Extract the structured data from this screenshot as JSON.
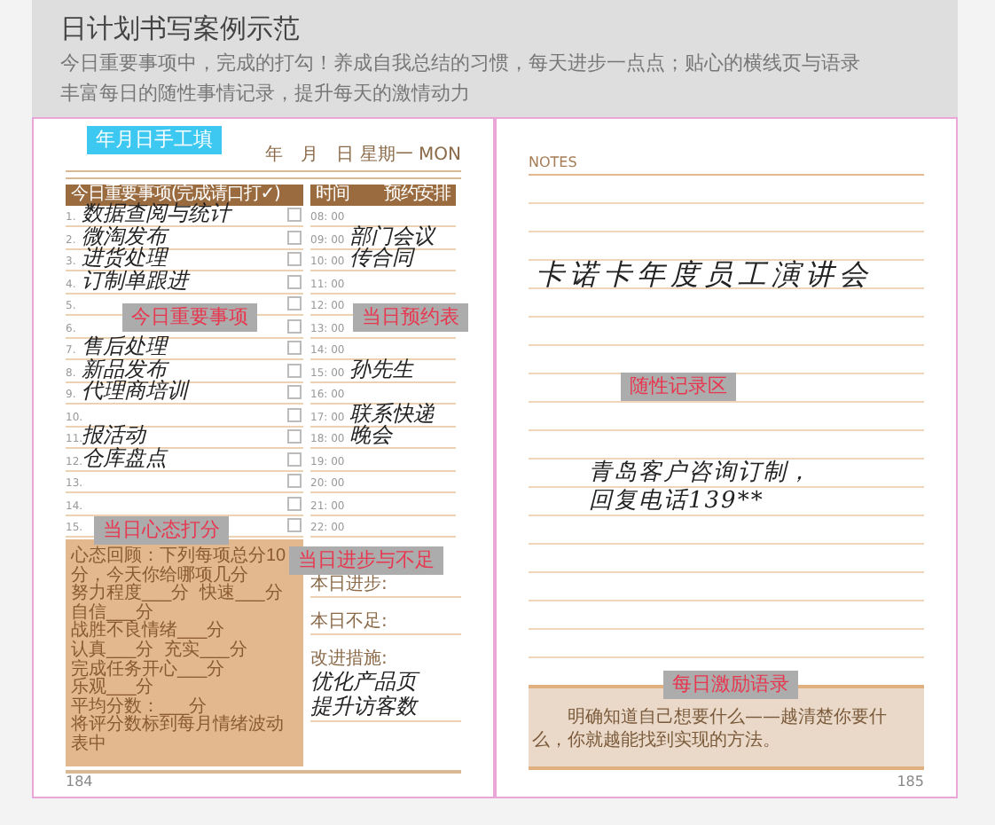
{
  "header": {
    "title": "日计划书写案例示范",
    "description": [
      "今日重要事项中，完成的打勾！养成自我总结的习惯，每天进步一点点；贴心的横线页与语录",
      "丰富每日的随性事情记录，提升每天的激情动力"
    ]
  },
  "left_page": {
    "date_callout": "年月日手工填",
    "date_line": "年　月　日 星期一 MON",
    "tasks_heading": "今日重要事项(完成请口打✓)",
    "time_heading": "时间",
    "appointment_heading": "预约安排",
    "tasks_callout": "今日重要事项",
    "schedule_callout": "当日预约表",
    "rows": [
      {
        "number": "1.",
        "task": "数据查阅与统计",
        "checked": false,
        "time": "08: 00"
      },
      {
        "number": "2.",
        "task": "微淘发布",
        "checked": false,
        "time": "09: 00",
        "appointment": "部门会议"
      },
      {
        "number": "3.",
        "task": "进货处理",
        "checked": false,
        "time": "10: 00",
        "appointment": "传合同"
      },
      {
        "number": "4.",
        "task": "订制单跟进",
        "checked": false,
        "time": "11: 00"
      },
      {
        "number": "5.",
        "checked": false,
        "time": "12: 00"
      },
      {
        "number": "6.",
        "checked": false,
        "time": "13: 00"
      },
      {
        "number": "7.",
        "task": "售后处理",
        "checked": false,
        "time": "14: 00"
      },
      {
        "number": "8.",
        "task": "新品发布",
        "checked": false,
        "time": "15: 00",
        "appointment": "孙先生"
      },
      {
        "number": "9.",
        "task": "代理商培训",
        "checked": false,
        "time": "16: 00"
      },
      {
        "number": "10.",
        "checked": false,
        "time": "17: 00",
        "appointment": "联系快递"
      },
      {
        "number": "11.",
        "task": "报活动",
        "checked": false,
        "time": "18: 00",
        "appointment": "晚会"
      },
      {
        "number": "12.",
        "task": "仓库盘点",
        "checked": false,
        "time": "19: 00"
      },
      {
        "number": "13.",
        "checked": false,
        "time": "20: 00"
      },
      {
        "number": "14.",
        "checked": false,
        "time": "21: 00"
      },
      {
        "number": "15.",
        "checked": false,
        "time": "22: 00"
      }
    ],
    "mood_callout": "当日心态打分",
    "mood_lines": [
      [
        "心态回顾：下列每项总分10分，今天你给哪项几分"
      ],
      [
        "努力程度___分",
        "快速___分",
        "自信___分"
      ],
      [
        "战胜不良情绪___分",
        "认真___分",
        "充实___分"
      ],
      [
        "完成任务开心___分",
        "乐观___分"
      ],
      [
        "平均分数：___分",
        "将评分数标到每月情绪波动表中"
      ]
    ],
    "progress_callout": "当日进步与不足",
    "progress_fields": [
      {
        "label": "本日进步:"
      },
      {
        "label": "本日不足:"
      },
      {
        "label": "改进措施:",
        "entries": [
          "优化产品页",
          "提升访客数"
        ]
      }
    ],
    "page_number": "184"
  },
  "right_page": {
    "notes_label": "NOTES",
    "notes": [
      [
        "卡诺卡年度员工演讲会"
      ],
      [
        "青岛客户咨询订制，",
        "回复电话139**"
      ]
    ],
    "notes_callout": "随性记录区",
    "motto_callout": "每日激励语录",
    "motto": "明确知道自己想要什么——越清楚你要什么，你就越能找到实现的方法。",
    "page_number": "185"
  }
}
